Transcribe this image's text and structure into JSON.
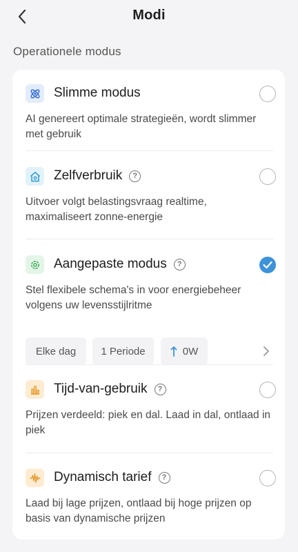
{
  "header": {
    "title": "Modi"
  },
  "section": {
    "title": "Operationele modus"
  },
  "modes": [
    {
      "name": "Slimme modus",
      "description": "AI genereert optimale strategieën, wordt slimmer met gebruik",
      "icon": "atom-icon",
      "help": false,
      "selected": false,
      "icon_bg": "#e3ecfb",
      "icon_color": "#3b73d6"
    },
    {
      "name": "Zelfverbruik",
      "description": "Uitvoer volgt belastingsvraag realtime, maximaliseert zonne-energie",
      "icon": "home-sun-icon",
      "help": true,
      "selected": false,
      "icon_bg": "#e2f2fa",
      "icon_color": "#2d9ad1"
    },
    {
      "name": "Aangepaste modus",
      "description": "Stel flexibele schema's in voor energiebeheer volgens uw levensstijlritme",
      "icon": "gear-icon",
      "help": true,
      "selected": true,
      "icon_bg": "#e4f5e8",
      "icon_color": "#3aa85a"
    },
    {
      "name": "Tijd-van-gebruik",
      "description": "Prijzen verdeeld: piek en dal. Laad in dal, ontlaad in piek",
      "icon": "bar-chart-icon",
      "help": true,
      "selected": false,
      "icon_bg": "#fdecd2",
      "icon_color": "#e89a2b"
    },
    {
      "name": "Dynamisch tarief",
      "description": "Laad bij lage prijzen, ontlaad bij hoge prijzen op basis van dynamische prijzen",
      "icon": "waveform-icon",
      "help": true,
      "selected": false,
      "icon_bg": "#fdecd2",
      "icon_color": "#e89a2b"
    }
  ],
  "custom_chips": {
    "day": "Elke dag",
    "period": "1 Periode",
    "power": "0W"
  },
  "colors": {
    "accent": "#3d93d9",
    "background": "#f4f4f6"
  }
}
